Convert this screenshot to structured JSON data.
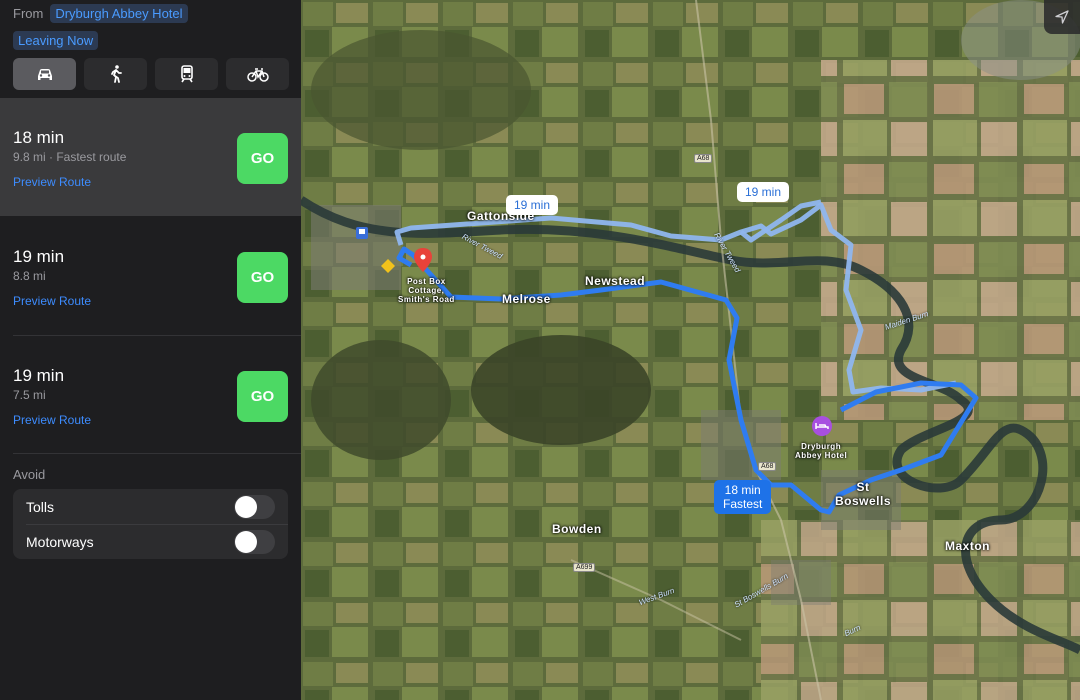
{
  "directions": {
    "from_label": "From",
    "from_value": "Dryburgh Abbey Hotel",
    "depart": "Leaving Now",
    "modes": [
      {
        "name": "drive",
        "icon": "car-icon",
        "selected": true
      },
      {
        "name": "walk",
        "icon": "walk-icon",
        "selected": false
      },
      {
        "name": "transit",
        "icon": "train-icon",
        "selected": false
      },
      {
        "name": "cycle",
        "icon": "bike-icon",
        "selected": false
      }
    ],
    "routes": [
      {
        "time": "18 min",
        "detail": "9.8 mi · Fastest route",
        "preview": "Preview Route",
        "go": "GO",
        "selected": true
      },
      {
        "time": "19 min",
        "detail": "8.8 mi",
        "preview": "Preview Route",
        "go": "GO",
        "selected": false
      },
      {
        "time": "19 min",
        "detail": "7.5 mi",
        "preview": "Preview Route",
        "go": "GO",
        "selected": false
      }
    ],
    "avoid": {
      "title": "Avoid",
      "options": [
        {
          "label": "Tolls",
          "on": false
        },
        {
          "label": "Motorways",
          "on": false
        }
      ]
    }
  },
  "map": {
    "places": {
      "gattonside": "Gattonside",
      "melrose": "Melrose",
      "newstead": "Newstead",
      "bowden": "Bowden",
      "st_boswells": "St\nBoswells",
      "maxton": "Maxton"
    },
    "pins": {
      "start": "Post Box\nCottage,\nSmith's Road",
      "end": "Dryburgh\nAbbey Hotel"
    },
    "water": {
      "tweed": "River Tweed",
      "tweed2": "River Tweed",
      "maiden": "Maiden Burn",
      "west": "West Burn",
      "stboswells": "St Boswells Burn",
      "burn": "Burn"
    },
    "roads": {
      "a68_north": "A68",
      "a68_south": "A68",
      "a699": "A699"
    },
    "route_labels": {
      "alt1": "19 min",
      "alt2": "19 min",
      "fastest_time": "18 min",
      "fastest_tag": "Fastest"
    },
    "colors": {
      "route_primary": "#2f7cf0",
      "route_alt": "#8fb6ee",
      "go_button": "#4cd964",
      "link": "#3d8cff"
    }
  }
}
